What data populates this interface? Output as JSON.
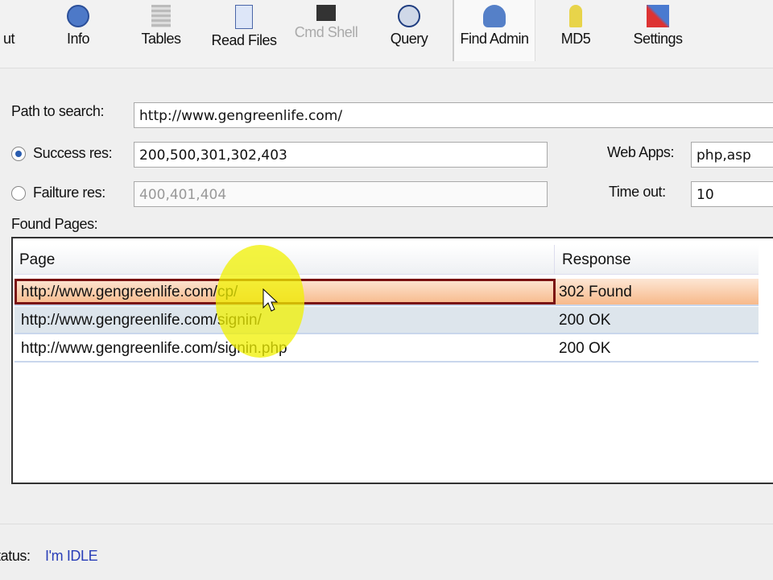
{
  "toolbar": {
    "items": [
      {
        "label": "ut"
      },
      {
        "label": "Info"
      },
      {
        "label": "Tables"
      },
      {
        "label": "Read Files"
      },
      {
        "label": "Cmd Shell"
      },
      {
        "label": "Query"
      },
      {
        "label": "Find Admin"
      },
      {
        "label": "MD5"
      },
      {
        "label": "Settings"
      }
    ]
  },
  "form": {
    "path_label": "Path to search:",
    "path_value": "http://www.gengreenlife.com/",
    "success_label": "Success res:",
    "success_value": "200,500,301,302,403",
    "failure_label": "Failture res:",
    "failure_value": "400,401,404",
    "webapps_label": "Web Apps:",
    "webapps_value": "php,asp",
    "timeout_label": "Time out:",
    "timeout_value": "10",
    "found_label": "Found Pages:"
  },
  "table": {
    "columns": [
      "Page",
      "Response"
    ],
    "rows": [
      {
        "page": "http://www.gengreenlife.com/cp/",
        "response": "302 Found"
      },
      {
        "page": "http://www.gengreenlife.com/signin/",
        "response": "200 OK"
      },
      {
        "page": "http://www.gengreenlife.com/signin.php",
        "response": "200 OK"
      }
    ]
  },
  "status": {
    "label": "tatus:",
    "value": "I'm IDLE"
  }
}
